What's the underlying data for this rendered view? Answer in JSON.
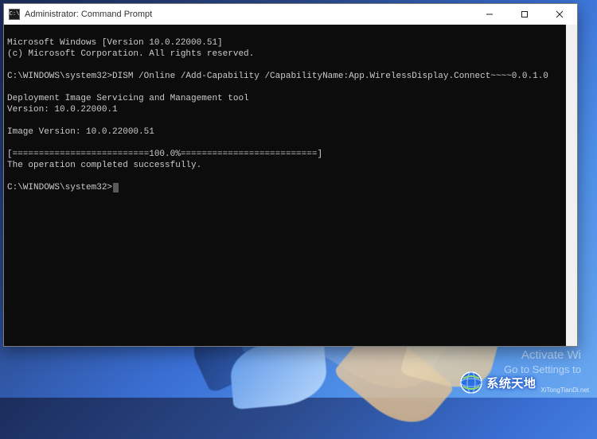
{
  "window": {
    "title": "Administrator: Command Prompt",
    "icon_label": "C:\\",
    "controls": {
      "minimize": "—",
      "maximize": "☐",
      "close": "✕"
    }
  },
  "console": {
    "lines": [
      "Microsoft Windows [Version 10.0.22000.51]",
      "(c) Microsoft Corporation. All rights reserved.",
      "",
      "C:\\WINDOWS\\system32>DISM /Online /Add-Capability /CapabilityName:App.WirelessDisplay.Connect~~~~0.0.1.0",
      "",
      "Deployment Image Servicing and Management tool",
      "Version: 10.0.22000.1",
      "",
      "Image Version: 10.0.22000.51",
      "",
      "[==========================100.0%==========================]",
      "The operation completed successfully.",
      "",
      "C:\\WINDOWS\\system32>"
    ]
  },
  "desktop": {
    "activate_line1": "Activate Wi",
    "activate_line2": "Go to Settings to"
  },
  "watermark": {
    "brand": "系统天地",
    "url": "XiTongTianDi.net"
  }
}
